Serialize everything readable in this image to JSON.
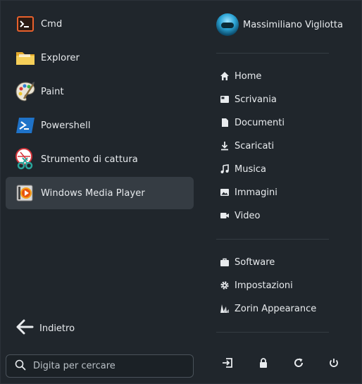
{
  "apps": [
    {
      "label": "Cmd",
      "icon": "cmd-icon"
    },
    {
      "label": "Explorer",
      "icon": "folder-icon"
    },
    {
      "label": "Paint",
      "icon": "paint-palette-icon"
    },
    {
      "label": "Powershell",
      "icon": "powershell-icon"
    },
    {
      "label": "Strumento di cattura",
      "icon": "snipping-tool-icon"
    },
    {
      "label": "Windows Media Player",
      "icon": "media-player-icon"
    }
  ],
  "back": {
    "label": "Indietro",
    "icon": "arrow-left-icon"
  },
  "search": {
    "placeholder": "Digita per cercare",
    "icon": "search-icon"
  },
  "user": {
    "name": "Massimiliano Vigliotta"
  },
  "places": [
    {
      "label": "Home",
      "icon": "home-icon"
    },
    {
      "label": "Scrivania",
      "icon": "desktop-icon"
    },
    {
      "label": "Documenti",
      "icon": "document-icon"
    },
    {
      "label": "Scaricati",
      "icon": "download-icon"
    },
    {
      "label": "Musica",
      "icon": "music-icon"
    },
    {
      "label": "Immagini",
      "icon": "image-icon"
    },
    {
      "label": "Video",
      "icon": "video-icon"
    }
  ],
  "system": [
    {
      "label": "Software",
      "icon": "briefcase-icon"
    },
    {
      "label": "Impostazioni",
      "icon": "gear-icon"
    },
    {
      "label": "Zorin Appearance",
      "icon": "appearance-icon"
    }
  ],
  "power": [
    {
      "icon": "logout-icon"
    },
    {
      "icon": "lock-icon"
    },
    {
      "icon": "restart-icon"
    },
    {
      "icon": "power-icon"
    }
  ],
  "colors": {
    "background": "#20262c",
    "highlight": "#353c43",
    "text": "#e8ebee"
  }
}
